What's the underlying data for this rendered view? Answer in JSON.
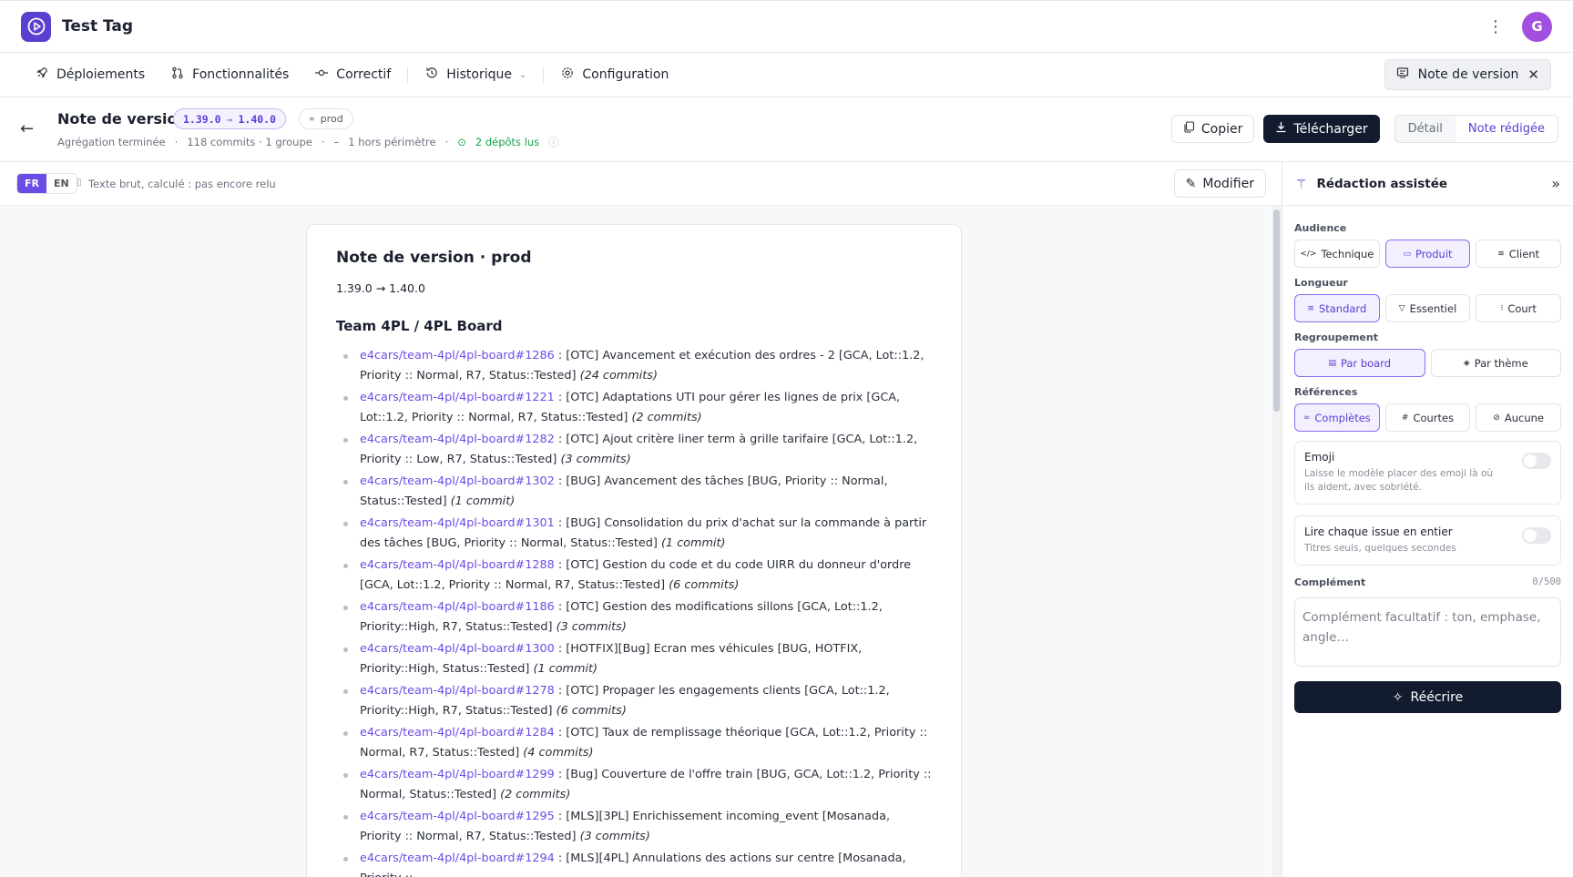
{
  "app": {
    "title": "Test Tag",
    "avatar_initial": "G"
  },
  "nav": {
    "items": [
      {
        "label": "Déploiements"
      },
      {
        "label": "Fonctionnalités"
      },
      {
        "label": "Correctif"
      },
      {
        "label": "Historique"
      },
      {
        "label": "Configuration"
      }
    ],
    "active_tab": "Note de version"
  },
  "header": {
    "title": "Note de version",
    "version_from": "1.39.0",
    "version_to": "1.40.0",
    "env": "prod",
    "meta_status": "Agrégation terminée",
    "meta_commits": "118 commits · 1 groupe",
    "meta_out": "1 hors périmètre",
    "meta_repos": "2 dépôts lus",
    "copy_label": "Copier",
    "download_label": "Télécharger",
    "view_detail": "Détail",
    "view_note": "Note rédigée"
  },
  "subbar": {
    "lang_fr": "FR",
    "lang_en": "EN",
    "hint": "Texte brut, calculé : pas encore relu",
    "edit_label": "Modifier"
  },
  "note": {
    "title": "Note de version · prod",
    "range": "1.39.0 → 1.40.0",
    "section": "Team 4PL / 4PL Board",
    "items": [
      {
        "ref": "e4cars/team-4pl/4pl-board#1286",
        "text": " : [OTC] Avancement et exécution des ordres - 2 [GCA, Lot::1.2, Priority :: Normal, R7, Status::Tested] ",
        "count": "(24 commits)"
      },
      {
        "ref": "e4cars/team-4pl/4pl-board#1221",
        "text": " : [OTC] Adaptations UTI pour gérer les lignes de prix [GCA, Lot::1.2, Priority :: Normal, R7, Status::Tested] ",
        "count": "(2 commits)"
      },
      {
        "ref": "e4cars/team-4pl/4pl-board#1282",
        "text": " : [OTC] Ajout critère liner term à grille tarifaire [GCA, Lot::1.2, Priority :: Low, R7, Status::Tested] ",
        "count": "(3 commits)"
      },
      {
        "ref": "e4cars/team-4pl/4pl-board#1302",
        "text": " : [BUG] Avancement des tâches [BUG, Priority :: Normal, Status::Tested] ",
        "count": "(1 commit)"
      },
      {
        "ref": "e4cars/team-4pl/4pl-board#1301",
        "text": " : [BUG] Consolidation du prix d'achat sur la commande à partir des tâches [BUG, Priority :: Normal, Status::Tested] ",
        "count": "(1 commit)"
      },
      {
        "ref": "e4cars/team-4pl/4pl-board#1288",
        "text": " : [OTC] Gestion du code et du code UIRR du donneur d'ordre [GCA, Lot::1.2, Priority :: Normal, R7, Status::Tested] ",
        "count": "(6 commits)"
      },
      {
        "ref": "e4cars/team-4pl/4pl-board#1186",
        "text": " : [OTC] Gestion des modifications sillons [GCA, Lot::1.2, Priority::High, R7, Status::Tested] ",
        "count": "(3 commits)"
      },
      {
        "ref": "e4cars/team-4pl/4pl-board#1300",
        "text": " : [HOTFIX][Bug] Ecran mes véhicules [BUG, HOTFIX, Priority::High, Status::Tested] ",
        "count": "(1 commit)"
      },
      {
        "ref": "e4cars/team-4pl/4pl-board#1278",
        "text": " : [OTC] Propager les engagements clients [GCA, Lot::1.2, Priority::High, R7, Status::Tested] ",
        "count": "(6 commits)"
      },
      {
        "ref": "e4cars/team-4pl/4pl-board#1284",
        "text": " : [OTC] Taux de remplissage théorique [GCA, Lot::1.2, Priority :: Normal, R7, Status::Tested] ",
        "count": "(4 commits)"
      },
      {
        "ref": "e4cars/team-4pl/4pl-board#1299",
        "text": " : [Bug] Couverture de l'offre train [BUG, GCA, Lot::1.2, Priority :: Normal, Status::Tested] ",
        "count": "(2 commits)"
      },
      {
        "ref": "e4cars/team-4pl/4pl-board#1295",
        "text": " : [MLS][3PL] Enrichissement incoming_event [Mosanada, Priority :: Normal, R7, Status::Tested] ",
        "count": "(3 commits)"
      },
      {
        "ref": "e4cars/team-4pl/4pl-board#1294",
        "text": " : [MLS][4PL] Annulations des actions sur centre [Mosanada, Priority :: ",
        "count": ""
      }
    ]
  },
  "panel": {
    "title": "Rédaction assistée",
    "audience_label": "Audience",
    "audience": [
      "Technique",
      "Produit",
      "Client"
    ],
    "length_label": "Longueur",
    "length": [
      "Standard",
      "Essentiel",
      "Court"
    ],
    "grouping_label": "Regroupement",
    "grouping": [
      "Par board",
      "Par thème"
    ],
    "refs_label": "Références",
    "refs": [
      "Complètes",
      "Courtes",
      "Aucune"
    ],
    "emoji_title": "Emoji",
    "emoji_desc": "Laisse le modèle placer des emoji là où ils aident, avec sobriété.",
    "read_title": "Lire chaque issue en entier",
    "read_desc": "Titres seuls, quelques secondes",
    "complement_label": "Complément",
    "complement_count": "0/500",
    "complement_placeholder": "Complément facultatif : ton, emphase, angle…",
    "rewrite_label": "Réécrire"
  }
}
